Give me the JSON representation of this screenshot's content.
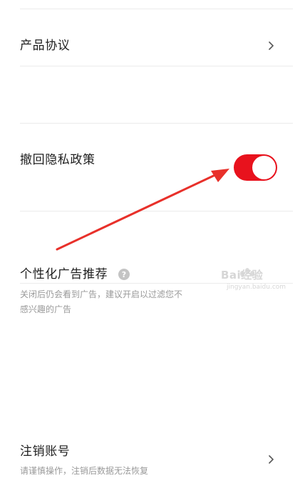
{
  "settings": {
    "items": [
      {
        "title": "产品协议",
        "subtitle": ""
      },
      {
        "title": "撤回隐私政策",
        "subtitle": ""
      },
      {
        "title": "个性化广告推荐",
        "subtitle_line1": "关闭后仍会看到广告，建议开启以过滤您不",
        "subtitle_line2": "感兴趣的广告",
        "toggle_on": true
      },
      {
        "title": "注销账号",
        "subtitle": "请谨慎操作，注销后数据无法恢复"
      }
    ]
  },
  "colors": {
    "accent": "#e8121d",
    "annotation_arrow": "#e8302a",
    "divider": "#ebebeb",
    "subtitle": "#9a9a9a",
    "chevron": "#555555"
  },
  "icons": {
    "chevron": "chevron-right-icon",
    "help": "question-circle-icon"
  },
  "watermark": {
    "brand": "Bai经验",
    "url": "jingyan.baidu.com"
  }
}
